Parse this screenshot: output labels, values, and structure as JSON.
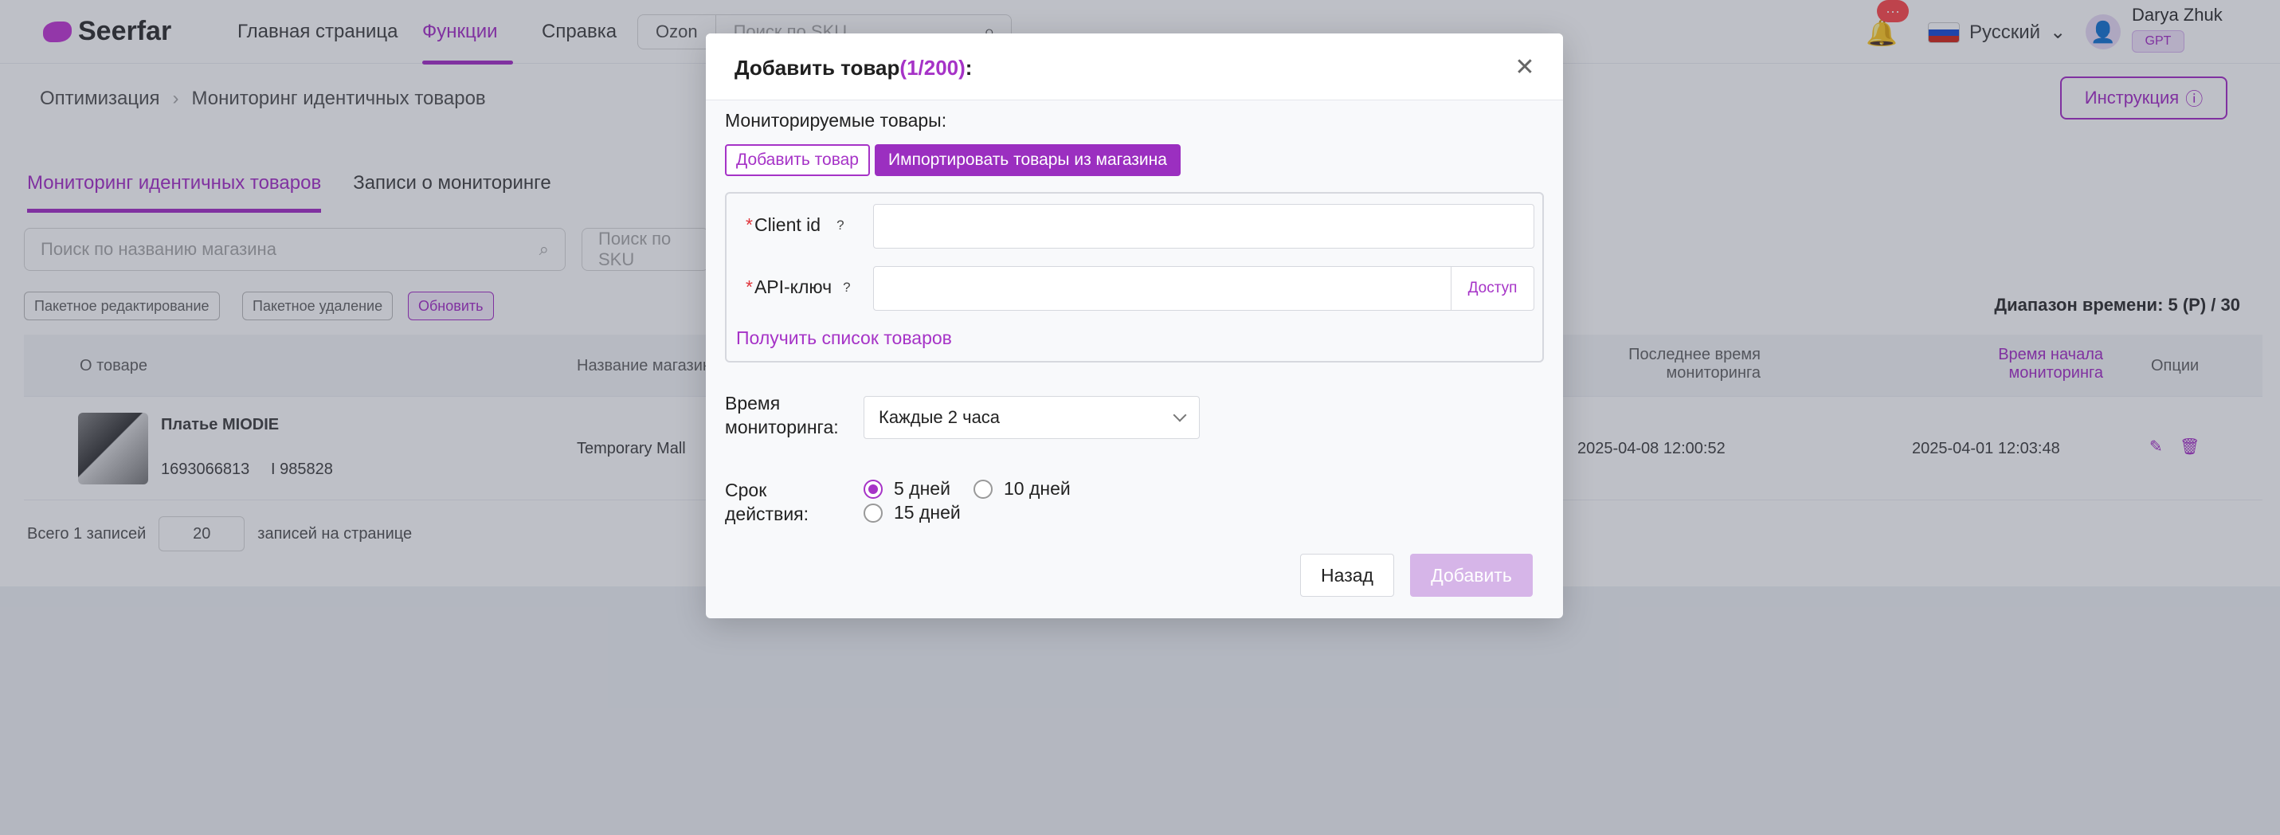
{
  "nav": {
    "logo": "Seerfar",
    "items": [
      "Главная страница",
      "Функции",
      "Справка"
    ],
    "search_scope": "Ozon",
    "search_placeholder": "Поиск по SKU",
    "notifications_count": "···",
    "language": "Русский",
    "user_name": "Darya Zhuk",
    "user_plan": "GPT"
  },
  "breadcrumb": [
    "Оптимизация",
    "Мониторинг идентичных товаров"
  ],
  "instructions_label": "Инструкция",
  "tabs": [
    "Мониторинг идентичных товаров",
    "Записи о мониторинге"
  ],
  "filters": {
    "store_search_placeholder": "Поиск по названию магазина",
    "sku_search_placeholder": "Поиск по SKU",
    "chips": [
      "Пакетное редактирование",
      "Пакетное удаление",
      "Обновить"
    ],
    "date_range": "Диапазон времени: 5 (Р) / 30"
  },
  "table": {
    "headers": [
      "О товаре",
      "Название магазина",
      "Последнее время мониторинга",
      "Время начала мониторинга",
      "Опции"
    ],
    "row": {
      "title": "Платье MIODIE",
      "sku": "1693066813",
      "meta": "I 985828",
      "store": "Temporary Mall",
      "last_monitor": "2025-04-08 12:00:52",
      "start_monitor": "2025-04-01 12:03:48"
    }
  },
  "pager": {
    "total": "Всего 1 записей",
    "page_size": "20",
    "per_page": "записей на странице"
  },
  "modal": {
    "title": "Добавить товар",
    "count": "(1/200)",
    "colon": ":",
    "monitored_label": "Мониторируемые товары:",
    "tab_add": "Добавить товар",
    "tab_import": "Импортировать товары из магазина",
    "client_id_label": "Client id",
    "api_key_label": "API-ключ",
    "required_mark": "*",
    "help_mark": "?",
    "access_label": "Доступ",
    "get_list_link": "Получить список товаров",
    "monitor_time_label": "Время мониторинга:",
    "monitor_time_value": "Каждые 2 часа",
    "duration_label": "Срок действия:",
    "duration_options": [
      "5 дней",
      "10 дней",
      "15 дней"
    ],
    "duration_selected": "5 дней",
    "back_label": "Назад",
    "add_label": "Добавить"
  }
}
